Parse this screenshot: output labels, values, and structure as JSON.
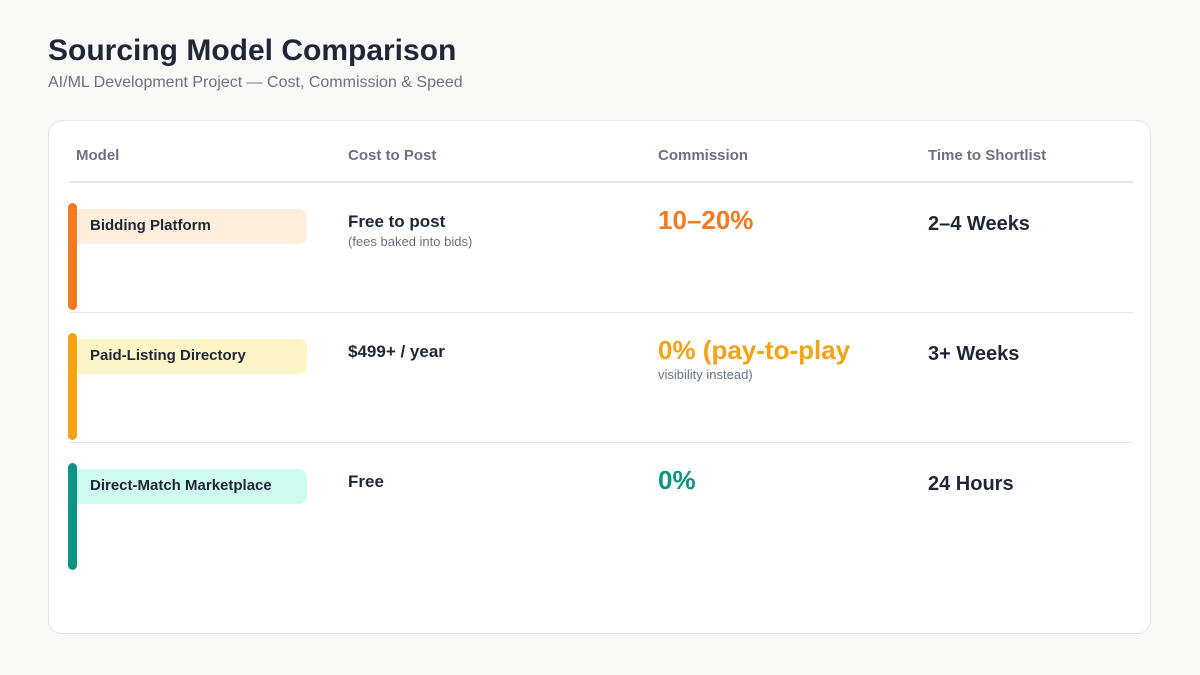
{
  "header": {
    "title": "Sourcing Model Comparison",
    "subtitle": "AI/ML Development Project — Cost, Commission & Speed"
  },
  "table": {
    "columns": [
      "Model",
      "Cost to Post",
      "Commission",
      "Time to Shortlist"
    ],
    "rows": [
      {
        "model": "Bidding Platform",
        "cost": "Free to post",
        "cost_note": "(fees baked into bids)",
        "commission": "10–20%",
        "commission_note": "",
        "time": "2–4 Weeks",
        "accent_color": "#f37a21",
        "pill_color": "#feeedb",
        "commission_color": "#f37a21"
      },
      {
        "model": "Paid-Listing Directory",
        "cost": "$499+ / year",
        "cost_note": "",
        "commission": "0% (pay-to-play",
        "commission_note": "visibility instead)",
        "time": "3+ Weeks",
        "accent_color": "#f3a313",
        "pill_color": "#fdf4c7",
        "commission_color": "#f3a313"
      },
      {
        "model": "Direct-Match Marketplace",
        "cost": "Free",
        "cost_note": "",
        "commission": "0%",
        "commission_note": "",
        "time": "24 Hours",
        "accent_color": "#0f9482",
        "pill_color": "#cffaf0",
        "commission_color": "#0f9482"
      }
    ]
  }
}
